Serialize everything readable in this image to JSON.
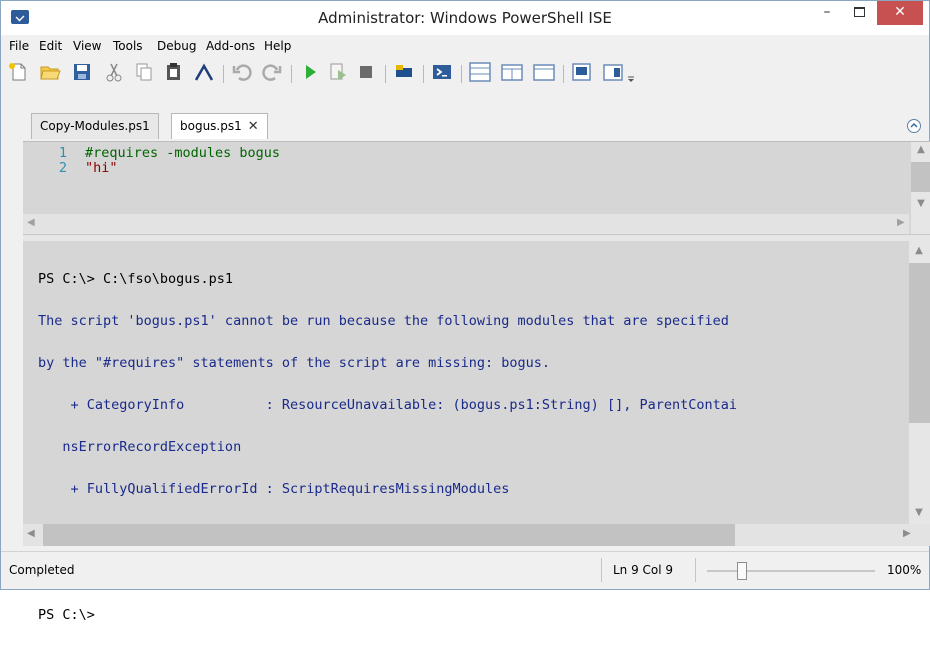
{
  "window": {
    "title": "Administrator: Windows PowerShell ISE",
    "minimize_glyph": "–",
    "close_glyph": "✕"
  },
  "menu": [
    "File",
    "Edit",
    "View",
    "Tools",
    "Debug",
    "Add-ons",
    "Help"
  ],
  "toolbar_icons": [
    "new-icon",
    "open-icon",
    "save-icon",
    "cut-icon",
    "copy-icon",
    "paste-icon",
    "clear-console-icon",
    "undo-icon",
    "redo-icon",
    "run-script-icon",
    "run-selection-icon",
    "stop-icon",
    "remote-powershell-icon",
    "start-powershell-icon",
    "show-script-pane-top-icon",
    "show-script-pane-right-icon",
    "show-script-pane-maximized-icon",
    "show-command-window-icon",
    "show-command-addon-icon",
    "toolbar-overflow-icon"
  ],
  "tabs": [
    {
      "label": "Copy-Modules.ps1",
      "active": false
    },
    {
      "label": "bogus.ps1",
      "active": true,
      "close_glyph": "✕"
    }
  ],
  "script": {
    "lines": [
      {
        "number": "1",
        "text": "#requires -modules bogus",
        "kind": "comment"
      },
      {
        "number": "2",
        "text": "\"hi\"",
        "kind": "string"
      }
    ]
  },
  "console": {
    "lines": [
      {
        "text": "PS C:\\> C:\\fso\\bogus.ps1",
        "kind": "prompt"
      },
      {
        "text": "The script 'bogus.ps1' cannot be run because the following modules that are specified",
        "kind": "error"
      },
      {
        "text": "by the \"#requires\" statements of the script are missing: bogus.",
        "kind": "error"
      },
      {
        "text": "    + CategoryInfo          : ResourceUnavailable: (bogus.ps1:String) [], ParentContai",
        "kind": "error"
      },
      {
        "text": "   nsErrorRecordException",
        "kind": "error"
      },
      {
        "text": "    + FullyQualifiedErrorId : ScriptRequiresMissingModules",
        "kind": "error"
      },
      {
        "text": "",
        "kind": "blank"
      },
      {
        "text": "",
        "kind": "blank"
      },
      {
        "text": "PS C:\\>",
        "kind": "prompt"
      }
    ]
  },
  "status": {
    "text": "Completed",
    "position": "Ln 9  Col 9",
    "zoom_level": 0.18,
    "zoom_label": "100%"
  },
  "colors": {
    "pane_background": "#d6d6d6",
    "comment": "#006400",
    "string": "#8b0000",
    "line_number": "#2b91af",
    "error_text": "#1a2a8a",
    "close_button": "#c75050"
  }
}
